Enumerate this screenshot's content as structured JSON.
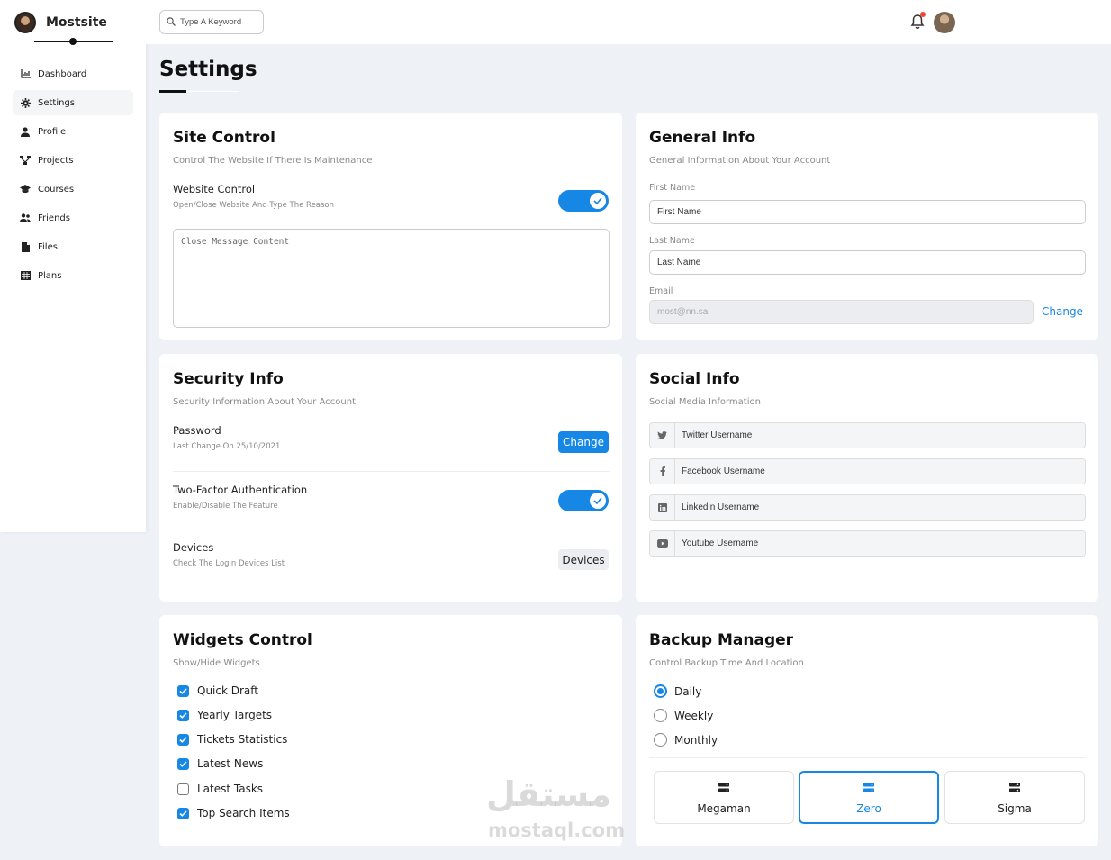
{
  "brand": {
    "name": "Mostsite"
  },
  "sidebar": {
    "items": [
      {
        "label": "Dashboard",
        "icon": "chart-area-icon",
        "active": false
      },
      {
        "label": "Settings",
        "icon": "gear-icon",
        "active": true
      },
      {
        "label": "Profile",
        "icon": "user-icon",
        "active": false
      },
      {
        "label": "Projects",
        "icon": "diagram-icon",
        "active": false
      },
      {
        "label": "Courses",
        "icon": "graduation-cap-icon",
        "active": false
      },
      {
        "label": "Friends",
        "icon": "users-icon",
        "active": false
      },
      {
        "label": "Files",
        "icon": "file-icon",
        "active": false
      },
      {
        "label": "Plans",
        "icon": "table-icon",
        "active": false
      }
    ]
  },
  "header": {
    "search_placeholder": "Type A Keyword"
  },
  "page": {
    "title": "Settings"
  },
  "site_control": {
    "title": "Site Control",
    "subtitle": "Control The Website If There Is Maintenance",
    "row_title": "Website Control",
    "row_desc": "Open/Close Website And Type The Reason",
    "toggle_on": true,
    "message_placeholder": "Close Message Content"
  },
  "general_info": {
    "title": "General Info",
    "subtitle": "General Information About Your Account",
    "first_name_label": "First Name",
    "first_name_placeholder": "First Name",
    "last_name_label": "Last Name",
    "last_name_placeholder": "Last Name",
    "email_label": "Email",
    "email_placeholder": "most@nn.sa",
    "change_link": "Change"
  },
  "security_info": {
    "title": "Security Info",
    "subtitle": "Security Information About Your Account",
    "password_title": "Password",
    "password_desc": "Last Change On 25/10/2021",
    "password_button": "Change",
    "twofa_title": "Two-Factor Authentication",
    "twofa_desc": "Enable/Disable The Feature",
    "twofa_on": true,
    "devices_title": "Devices",
    "devices_desc": "Check The Login Devices List",
    "devices_button": "Devices"
  },
  "social_info": {
    "title": "Social Info",
    "subtitle": "Social Media Information",
    "fields": [
      {
        "icon": "twitter-icon",
        "placeholder": "Twitter Username"
      },
      {
        "icon": "facebook-icon",
        "placeholder": "Facebook Username"
      },
      {
        "icon": "linkedin-icon",
        "placeholder": "Linkedin Username"
      },
      {
        "icon": "youtube-icon",
        "placeholder": "Youtube Username"
      }
    ]
  },
  "widgets_control": {
    "title": "Widgets Control",
    "subtitle": "Show/Hide Widgets",
    "items": [
      {
        "label": "Quick Draft",
        "checked": true
      },
      {
        "label": "Yearly Targets",
        "checked": true
      },
      {
        "label": "Tickets Statistics",
        "checked": true
      },
      {
        "label": "Latest News",
        "checked": true
      },
      {
        "label": "Latest Tasks",
        "checked": false
      },
      {
        "label": "Top Search Items",
        "checked": true
      }
    ]
  },
  "backup_manager": {
    "title": "Backup Manager",
    "subtitle": "Control Backup Time And Location",
    "options": [
      {
        "label": "Daily",
        "selected": true
      },
      {
        "label": "Weekly",
        "selected": false
      },
      {
        "label": "Monthly",
        "selected": false
      }
    ],
    "servers": [
      {
        "name": "Megaman",
        "active": false
      },
      {
        "name": "Zero",
        "active": true
      },
      {
        "name": "Sigma",
        "active": false
      }
    ]
  },
  "watermark": {
    "arabic": "مستقل",
    "latin": "mostaql.com"
  },
  "colors": {
    "accent": "#1787e5",
    "background": "#eef1f5",
    "notification": "#f44336"
  }
}
